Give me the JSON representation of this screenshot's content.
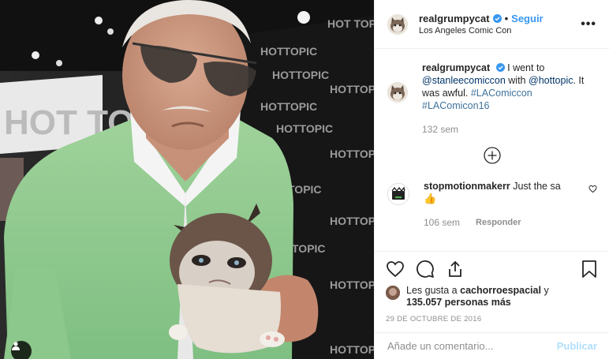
{
  "post": {
    "username": "realgrumpycat",
    "follow_label": "Seguir",
    "location": "Los Angeles Comic Con",
    "more_icon": "more-options-icon",
    "photo_description_icon": "user-tag-icon"
  },
  "caption": {
    "username": "realgrumpycat",
    "text_before": "I went to",
    "mention_1": "@stanleecomiccon",
    "text_middle": "with",
    "mention_2": "@hottopic",
    "text_after": ". It was awful.",
    "hashtag_1": "#LAComiccon",
    "hashtag_2": "#LAComicon16",
    "time": "132 sem"
  },
  "comment": {
    "username": "stopmotionmakerr",
    "text": "Just the sa",
    "emoji": "👍",
    "time": "106 sem",
    "reply_label": "Responder"
  },
  "actions": {
    "likes_prefix": "Les gusta a",
    "likes_user": "cachorroespacial",
    "likes_joiner": "y",
    "likes_count": "135.057 personas más",
    "date": "29 DE OCTUBRE DE 2016"
  },
  "add_comment": {
    "placeholder": "Añade un comentario...",
    "publish_label": "Publicar"
  },
  "colors": {
    "link_blue": "#3897f0",
    "hashtag_blue": "#3f729b",
    "muted_gray": "#8e8e8e",
    "publish_disabled": "#b2dffc"
  }
}
